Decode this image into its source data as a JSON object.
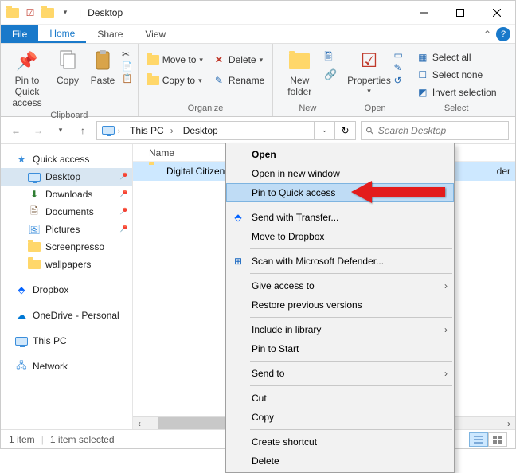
{
  "titlebar": {
    "title": "Desktop"
  },
  "tabs": {
    "file": "File",
    "home": "Home",
    "share": "Share",
    "view": "View"
  },
  "ribbon": {
    "clipboard": {
      "label": "Clipboard",
      "pin": "Pin to Quick\naccess",
      "copy": "Copy",
      "paste": "Paste"
    },
    "organize": {
      "label": "Organize",
      "moveto": "Move to",
      "copyto": "Copy to",
      "delete": "Delete",
      "rename": "Rename"
    },
    "new": {
      "label": "New",
      "newfolder": "New\nfolder"
    },
    "open": {
      "label": "Open",
      "properties": "Properties"
    },
    "select": {
      "label": "Select",
      "all": "Select all",
      "none": "Select none",
      "invert": "Invert selection"
    }
  },
  "address": {
    "seg1": "This PC",
    "seg2": "Desktop",
    "search_placeholder": "Search Desktop"
  },
  "nav": {
    "quick": "Quick access",
    "desktop": "Desktop",
    "downloads": "Downloads",
    "documents": "Documents",
    "pictures": "Pictures",
    "screenpresso": "Screenpresso",
    "wallpapers": "wallpapers",
    "dropbox": "Dropbox",
    "onedrive": "OneDrive - Personal",
    "thispc": "This PC",
    "network": "Network"
  },
  "content": {
    "col_name": "Name",
    "row1": "Digital Citizen",
    "row1_type_hint": "der"
  },
  "ctx": {
    "open": "Open",
    "open_new": "Open in new window",
    "pin_quick": "Pin to Quick access",
    "send_transfer": "Send with Transfer...",
    "move_dropbox": "Move to Dropbox",
    "scan_defender": "Scan with Microsoft Defender...",
    "give_access": "Give access to",
    "restore": "Restore previous versions",
    "include_lib": "Include in library",
    "pin_start": "Pin to Start",
    "send_to": "Send to",
    "cut": "Cut",
    "copy": "Copy",
    "create_shortcut": "Create shortcut",
    "delete": "Delete"
  },
  "status": {
    "count": "1 item",
    "selected": "1 item selected"
  }
}
